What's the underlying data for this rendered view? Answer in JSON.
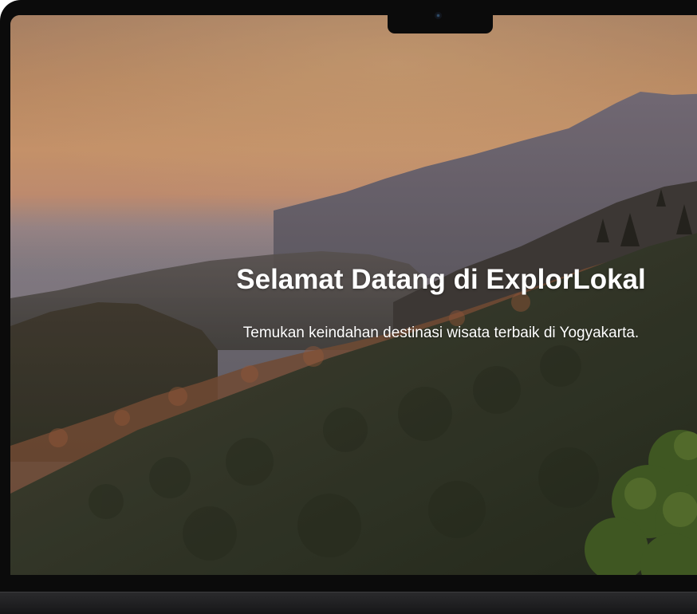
{
  "hero": {
    "title": "Selamat Datang di ExplorLokal",
    "subtitle": "Temukan keindahan destinasi wisata terbaik di Yogyakarta.",
    "background": "sunset-mountain-landscape"
  },
  "colors": {
    "text": "#ffffff",
    "bezel": "#0b0b0b",
    "sky_top": "#d89a6a",
    "sky_glow": "#f0b27a",
    "forest": "#3a3f2a"
  },
  "device": {
    "camera_icon": "camera-icon"
  }
}
